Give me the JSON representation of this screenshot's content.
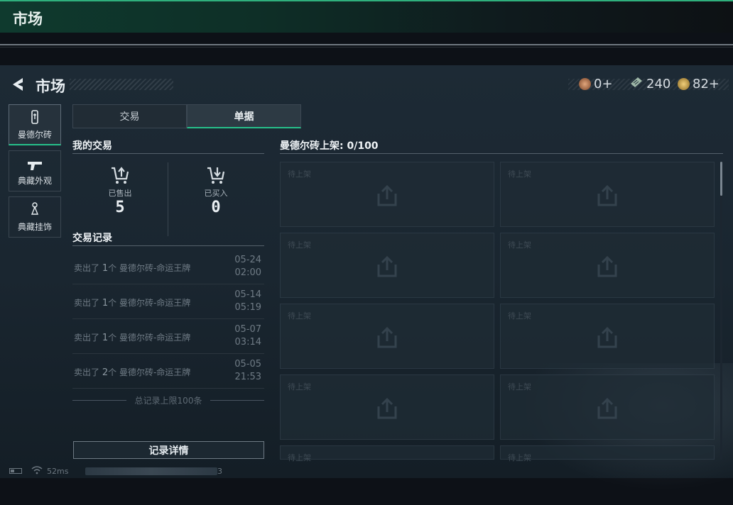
{
  "app": {
    "title": "市场"
  },
  "header": {
    "title": "市场"
  },
  "currencies": [
    {
      "icon": "medal-icon",
      "value": "0+",
      "color": "#b77a52"
    },
    {
      "icon": "ticket-icon",
      "value": "240",
      "color": "#9fb8a8"
    },
    {
      "icon": "coin-icon",
      "value": "82+",
      "color": "#c9a24a"
    }
  ],
  "sidebar": {
    "items": [
      {
        "label": "曼德尔砖",
        "icon": "brick-icon",
        "active": true
      },
      {
        "label": "典藏外观",
        "icon": "gun-icon",
        "active": false
      },
      {
        "label": "典藏挂饰",
        "icon": "charm-icon",
        "active": false
      }
    ]
  },
  "tabs": [
    {
      "label": "交易",
      "active": false
    },
    {
      "label": "单据",
      "active": true
    }
  ],
  "my_trades": {
    "title": "我的交易",
    "sold": {
      "label": "已售出",
      "value": "5"
    },
    "bought": {
      "label": "已买入",
      "value": "0"
    }
  },
  "records": {
    "title": "交易记录",
    "items": [
      {
        "prefix": "卖出了",
        "count": "1",
        "suffix": "个 曼德尔砖-命运王牌",
        "date": "05-24",
        "time": "02:00"
      },
      {
        "prefix": "卖出了",
        "count": "1",
        "suffix": "个 曼德尔砖-命运王牌",
        "date": "05-14",
        "time": "05:19"
      },
      {
        "prefix": "卖出了",
        "count": "1",
        "suffix": "个 曼德尔砖-命运王牌",
        "date": "05-07",
        "time": "03:14"
      },
      {
        "prefix": "卖出了",
        "count": "2",
        "suffix": "个 曼德尔砖-命运王牌",
        "date": "05-05",
        "time": "21:53"
      }
    ],
    "limit_text": "总记录上限100条",
    "detail_button": "记录详情"
  },
  "listing": {
    "title": "曼德尔砖上架: 0/100",
    "slot_label": "待上架",
    "slot_count": 10
  },
  "status": {
    "ping": "52ms",
    "tail": "3"
  }
}
